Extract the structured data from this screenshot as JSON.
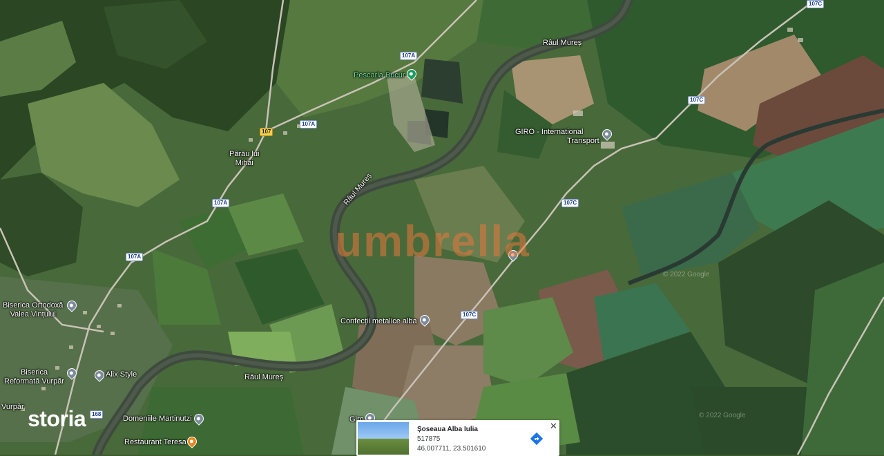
{
  "rivers": {
    "mures_top": "Râul Mureș",
    "mures_mid": "Râul Mureș",
    "mures_bottom": "Râul Mureș"
  },
  "roads": {
    "r107a_1": "107A",
    "r107a_2": "107A",
    "r107a_3": "107A",
    "r107a_4": "107A",
    "r107": "107",
    "r107c_1": "107C",
    "r107c_2": "107C",
    "r107c_3": "107C",
    "r107c_4": "107C",
    "r168": "168"
  },
  "places": {
    "parau_line1": "Pârâu lui",
    "parau_line2": "Mihai",
    "pescaria": "Pescaria Bucur",
    "giro_line1": "GIRO - International",
    "giro_line2": "Transport",
    "confectii": "Confecții metalice alba",
    "biserica_ortodoxa_line1": "Biserica Ortodoxă",
    "biserica_ortodoxa_line2": "Valea Vințului",
    "biserica_reformata_line1": "Biserica",
    "biserica_reformata_line2": "Reformată Vurpăr",
    "alix": "Alix Style",
    "vurpar": "Vurpăr",
    "domeniile": "Domeniile Martinutzi",
    "restaurant": "Restaurant Teresa",
    "giro_bottom": "Giro"
  },
  "watermark": "umbrella",
  "brand": "storia",
  "copyright": "© 2022 Google",
  "info_card": {
    "title": "Șoseaua Alba Iulia",
    "code": "517875",
    "coords": "46.007711, 23.501610",
    "directions_icon": "directions-icon",
    "close_icon": "close-icon"
  },
  "colors": {
    "river": "#3f4a3e",
    "road": "#c9c2b6",
    "forest": "#25401f",
    "field_green": "#4f7b3c",
    "field_brown": "#8c7a62",
    "accent": "#1a73e8"
  }
}
